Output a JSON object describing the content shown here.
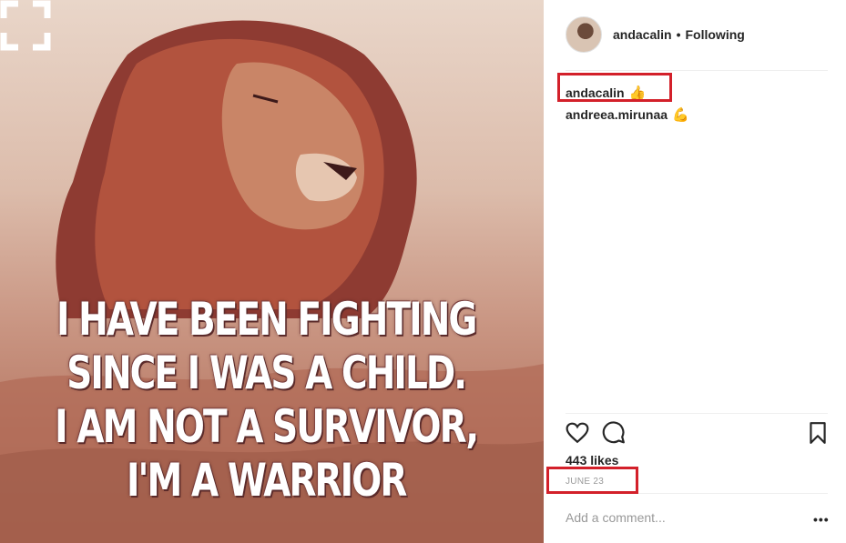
{
  "post": {
    "quote_lines": [
      "I HAVE BEEN FIGHTING",
      "SINCE I WAS A CHILD.",
      "I AM NOT A SURVIVOR,",
      "I'M A WARRIOR"
    ]
  },
  "header": {
    "username": "andacalin",
    "separator": "•",
    "follow_status": "Following"
  },
  "comments": [
    {
      "username": "andacalin",
      "emoji": "👍"
    },
    {
      "username": "andreea.mirunaa",
      "emoji": "💪"
    }
  ],
  "likes": "443 likes",
  "date": "JUNE 23",
  "add_comment": {
    "placeholder": "Add a comment..."
  },
  "more_label": "•••",
  "colors": {
    "highlight": "#d3202a",
    "text": "#262626",
    "muted": "#999999"
  }
}
